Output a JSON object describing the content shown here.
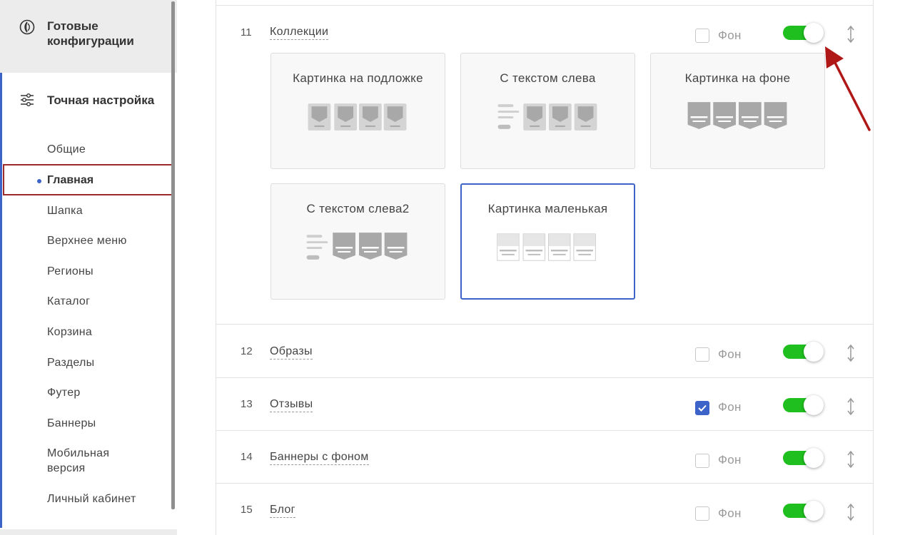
{
  "sidebar": {
    "ready_title": "Готовые конфигурации",
    "fine_title": "Точная настройка",
    "items": [
      "Общие",
      "Главная",
      "Шапка",
      "Верхнее меню",
      "Регионы",
      "Каталог",
      "Корзина",
      "Разделы",
      "Футер",
      "Баннеры",
      "Мобильная версия",
      "Личный кабинет"
    ],
    "active_index": 1
  },
  "rows": [
    {
      "num": "11",
      "name": "Коллекции",
      "fon_label": "Фон",
      "fon_checked": false,
      "enabled": true,
      "expanded": true
    },
    {
      "num": "12",
      "name": "Образы",
      "fon_label": "Фон",
      "fon_checked": false,
      "enabled": true
    },
    {
      "num": "13",
      "name": "Отзывы",
      "fon_label": "Фон",
      "fon_checked": true,
      "enabled": true
    },
    {
      "num": "14",
      "name": "Баннеры с фоном",
      "fon_label": "Фон",
      "fon_checked": false,
      "enabled": true
    },
    {
      "num": "15",
      "name": "Блог",
      "fon_label": "Фон",
      "fon_checked": false,
      "enabled": true
    }
  ],
  "templates": [
    {
      "title": "Картинка на подложке",
      "selected": false
    },
    {
      "title": "С текстом слева",
      "selected": false
    },
    {
      "title": "Картинка на фоне",
      "selected": false
    },
    {
      "title": "С текстом слева2",
      "selected": false
    },
    {
      "title": "Картинка маленькая",
      "selected": true
    }
  ],
  "colors": {
    "accent": "#3c64c8",
    "toggle_on": "#1fbf1f",
    "arrow": "#b01818"
  }
}
